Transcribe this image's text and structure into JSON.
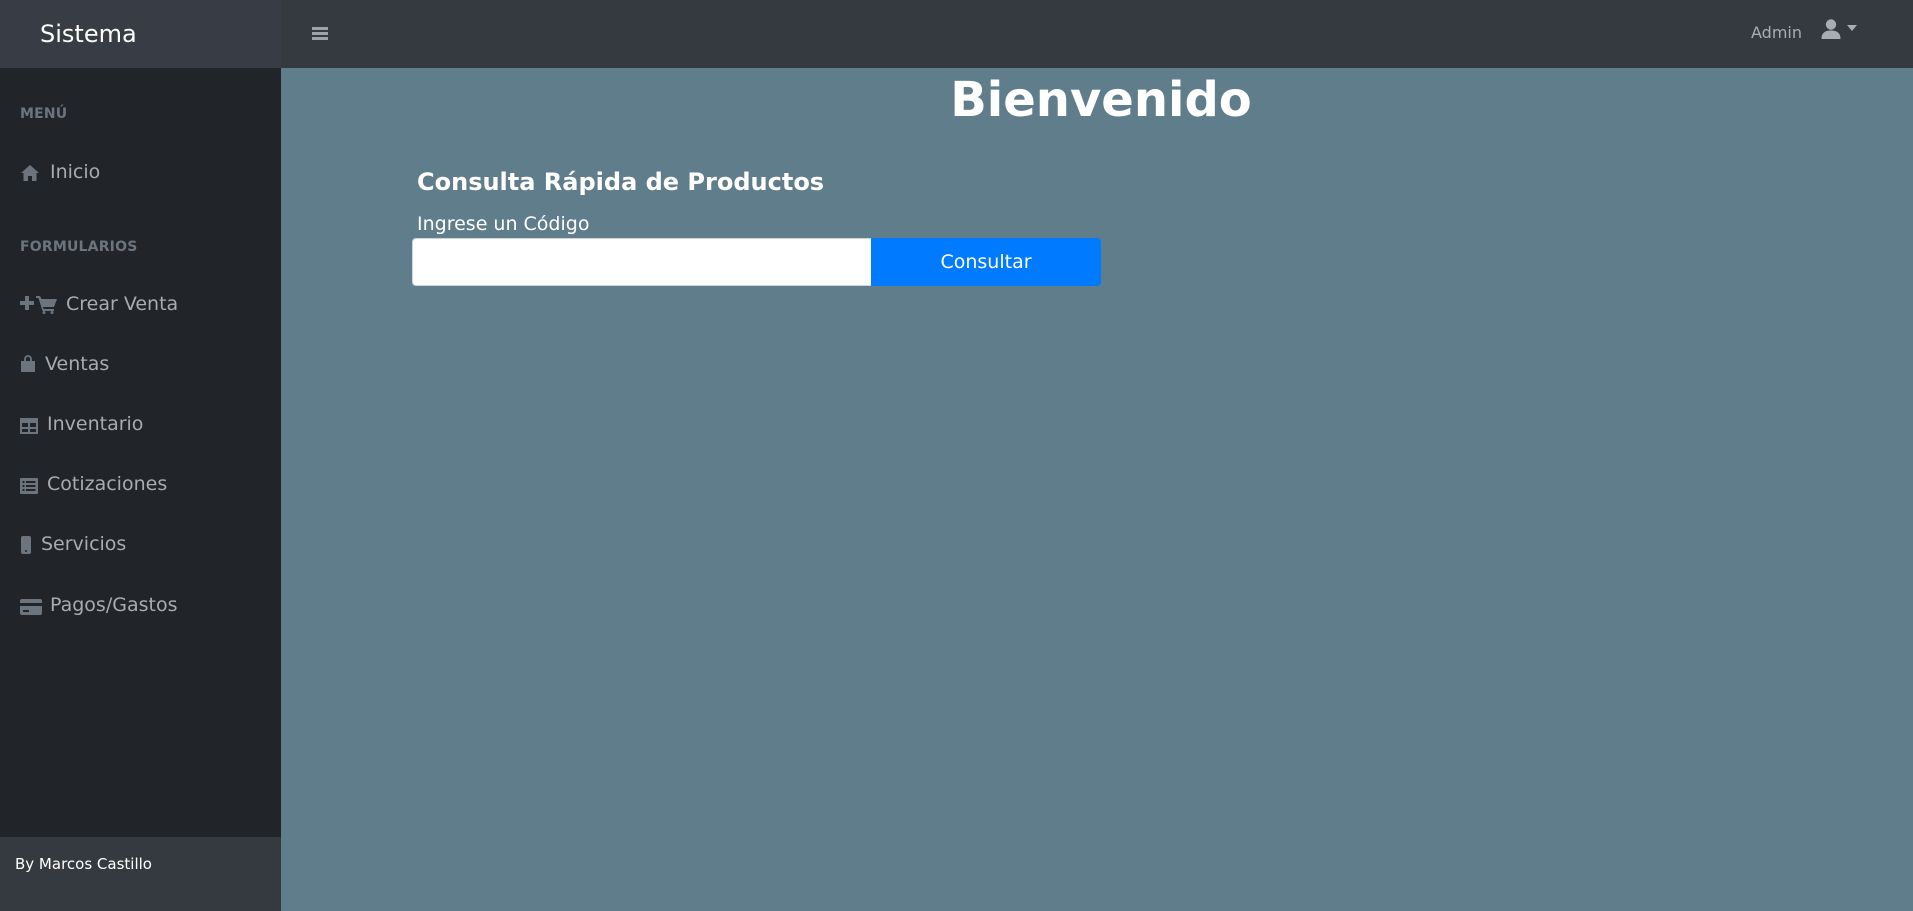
{
  "app": {
    "brand": "Sistema"
  },
  "topbar": {
    "menu_toggle_icon": "bars-icon",
    "user_name": "Admin",
    "user_icon": "user-icon",
    "user_caret_icon": "caret-down-icon"
  },
  "sidebar": {
    "sections": [
      {
        "heading": "MENÚ",
        "items": [
          {
            "label": "Inicio",
            "icon": "home-icon"
          }
        ]
      },
      {
        "heading": "FORMULARIOS",
        "items": [
          {
            "label": "Crear Venta",
            "icon": "add-to-cart-icon"
          },
          {
            "label": "Ventas",
            "icon": "shopping-bag-icon"
          },
          {
            "label": "Inventario",
            "icon": "table-icon"
          },
          {
            "label": "Cotizaciones",
            "icon": "list-icon"
          },
          {
            "label": "Servicios",
            "icon": "mobile-icon"
          },
          {
            "label": "Pagos/Gastos",
            "icon": "credit-card-icon"
          }
        ]
      }
    ],
    "footer": "By Marcos Castillo"
  },
  "main": {
    "title": "Bienvenido",
    "quick_search": {
      "title": "Consulta Rápida de Productos",
      "label": "Ingrese un Código",
      "input_value": "",
      "input_placeholder": "",
      "button_label": "Consultar"
    }
  },
  "colors": {
    "topbar": "#343a40",
    "brand_area": "#383d45",
    "sidebar": "#212529",
    "sidebar_footer": "#343a40",
    "main_background": "#607d8b",
    "primary_button": "#007bff",
    "sidebar_text": "#a8acb0",
    "sidebar_heading": "#6c757d"
  }
}
